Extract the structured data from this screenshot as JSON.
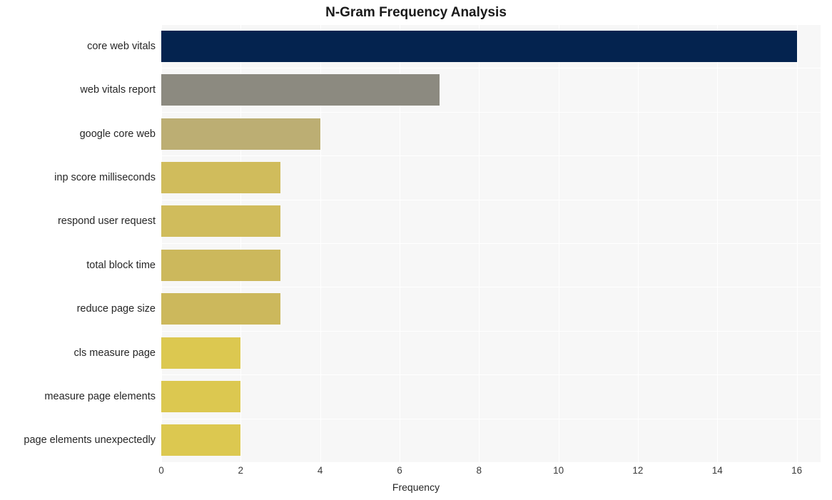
{
  "chart_data": {
    "type": "bar",
    "orientation": "horizontal",
    "title": "N-Gram Frequency Analysis",
    "xlabel": "Frequency",
    "ylabel": "",
    "categories": [
      "core web vitals",
      "web vitals report",
      "google core web",
      "inp score milliseconds",
      "respond user request",
      "total block time",
      "reduce page size",
      "cls measure page",
      "measure page elements",
      "page elements unexpectedly"
    ],
    "values": [
      16,
      7,
      4,
      3,
      3,
      3,
      3,
      2,
      2,
      2
    ],
    "bar_colors": [
      "#04234f",
      "#8c8a80",
      "#bcae73",
      "#d0bc5c",
      "#d0bc5c",
      "#ccb85c",
      "#ccb85c",
      "#dcc850",
      "#dcc850",
      "#dcc850"
    ],
    "xlim": [
      0,
      16.6
    ],
    "xticks": [
      0,
      2,
      4,
      6,
      8,
      10,
      12,
      14,
      16
    ],
    "xtick_labels": [
      "0",
      "2",
      "4",
      "6",
      "8",
      "10",
      "12",
      "14",
      "16"
    ],
    "grid": true,
    "grid_color": "#ffffff",
    "plot_background": "#f7f7f7",
    "figure_background": "#ffffff",
    "legend": null
  }
}
